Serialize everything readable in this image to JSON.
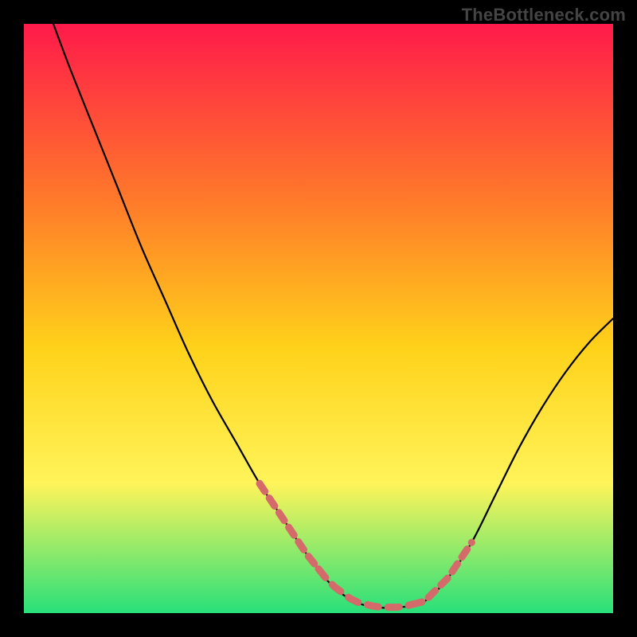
{
  "watermark": "TheBottleneck.com",
  "colors": {
    "frame": "#000000",
    "gradient_top": "#ff1a4a",
    "gradient_mid1": "#ff7a2a",
    "gradient_mid2": "#ffd21a",
    "gradient_mid3": "#fff45a",
    "gradient_bottom": "#28e07a",
    "curve": "#000000",
    "dotted": "#d46a6a"
  },
  "chart_data": {
    "type": "line",
    "title": "",
    "xlabel": "",
    "ylabel": "",
    "xlim": [
      0,
      100
    ],
    "ylim": [
      0,
      100
    ],
    "series": [
      {
        "name": "bottleneck-curve",
        "x": [
          5,
          8,
          12,
          16,
          20,
          24,
          28,
          32,
          36,
          40,
          44,
          48,
          52,
          56,
          60,
          64,
          68,
          72,
          76,
          80,
          84,
          88,
          92,
          96,
          100
        ],
        "values": [
          100,
          92,
          82,
          72,
          62,
          53,
          44,
          36,
          29,
          22,
          16,
          10,
          5,
          2,
          1,
          1,
          2,
          6,
          12,
          20,
          28,
          35,
          41,
          46,
          50
        ]
      }
    ],
    "annotations": [
      {
        "name": "dotted-left-segment",
        "x_range": [
          40,
          50
        ],
        "y_range": [
          22,
          6
        ]
      },
      {
        "name": "dotted-bottom-segment",
        "x_range": [
          50,
          66
        ],
        "y_range": [
          3,
          3
        ]
      },
      {
        "name": "dotted-right-segment",
        "x_range": [
          66,
          76
        ],
        "y_range": [
          4,
          20
        ]
      }
    ]
  }
}
